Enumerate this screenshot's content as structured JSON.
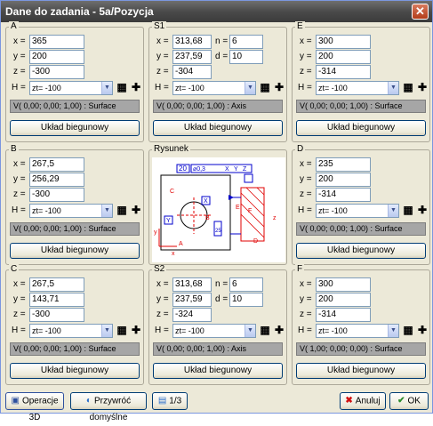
{
  "window": {
    "title": "Dane do zadania  - 5a/Pozycja"
  },
  "panels": {
    "A": {
      "label": "A",
      "x": "365",
      "y": "200",
      "z": "-300",
      "h": "zt= -100",
      "v": "V( 0,00;  0,00;  1,00) : Surface",
      "button": "Układ biegunowy"
    },
    "S1": {
      "label": "S1",
      "x": "313,68",
      "y": "237,59",
      "z": "-304",
      "n": "6",
      "d": "10",
      "h": "zt= -100",
      "v": "V( 0,00;  0,00;  1,00) : Axis",
      "button": "Układ biegunowy"
    },
    "E": {
      "label": "E",
      "x": "300",
      "y": "200",
      "z": "-314",
      "h": "zt= -100",
      "v": "V( 0,00;  0,00;  1,00) : Surface",
      "button": "Układ biegunowy"
    },
    "B": {
      "label": "B",
      "x": "267,5",
      "y": "256,29",
      "z": "-300",
      "h": "zt= -100",
      "v": "V( 0,00;  0,00;  1,00) : Surface",
      "button": "Układ biegunowy"
    },
    "D": {
      "label": "D",
      "x": "235",
      "y": "200",
      "z": "-314",
      "h": "zt= -100",
      "v": "V( 0,00;  0,00;  1,00) : Surface",
      "button": "Układ biegunowy"
    },
    "C": {
      "label": "C",
      "x": "267,5",
      "y": "143,71",
      "z": "-300",
      "h": "zt= -100",
      "v": "V( 0,00;  0,00;  1,00) : Surface",
      "button": "Układ biegunowy"
    },
    "S2": {
      "label": "S2",
      "x": "313,68",
      "y": "237,59",
      "z": "-324",
      "n": "6",
      "d": "10",
      "h": "zt= -100",
      "v": "V( 0,00;  0,00;  1,00) : Axis",
      "button": "Układ biegunowy"
    },
    "F": {
      "label": "F",
      "x": "300",
      "y": "200",
      "z": "-314",
      "h": "zt= -100",
      "v": "V( 1,00;  0,00;  0,00) : Surface",
      "button": "Układ biegunowy"
    }
  },
  "drawing": {
    "label": "Rysunek",
    "dim_20": "20",
    "tol": "⌀0,3",
    "x": "X",
    "y": "Y",
    "z": "Z",
    "box_x": "X",
    "box_y": "Y",
    "dim_25": "25",
    "letters": {
      "A": "A",
      "B": "B",
      "C": "C",
      "D": "D",
      "E": "E",
      "F": "F",
      "x": "x",
      "y": "y",
      "z": "z"
    }
  },
  "labels": {
    "x": "x =",
    "y": "y =",
    "z": "z =",
    "n": "n =",
    "d": "d =",
    "H": "H ="
  },
  "bottombar": {
    "ops3d": "Operacje 3D",
    "restore": "Przywróć domyślne",
    "page": "1/3",
    "cancel": "Anuluj",
    "ok": "OK"
  },
  "colors": {
    "accent_red": "#e00000",
    "accent_blue": "#0000cc",
    "ok_green": "#2a8a2a"
  }
}
